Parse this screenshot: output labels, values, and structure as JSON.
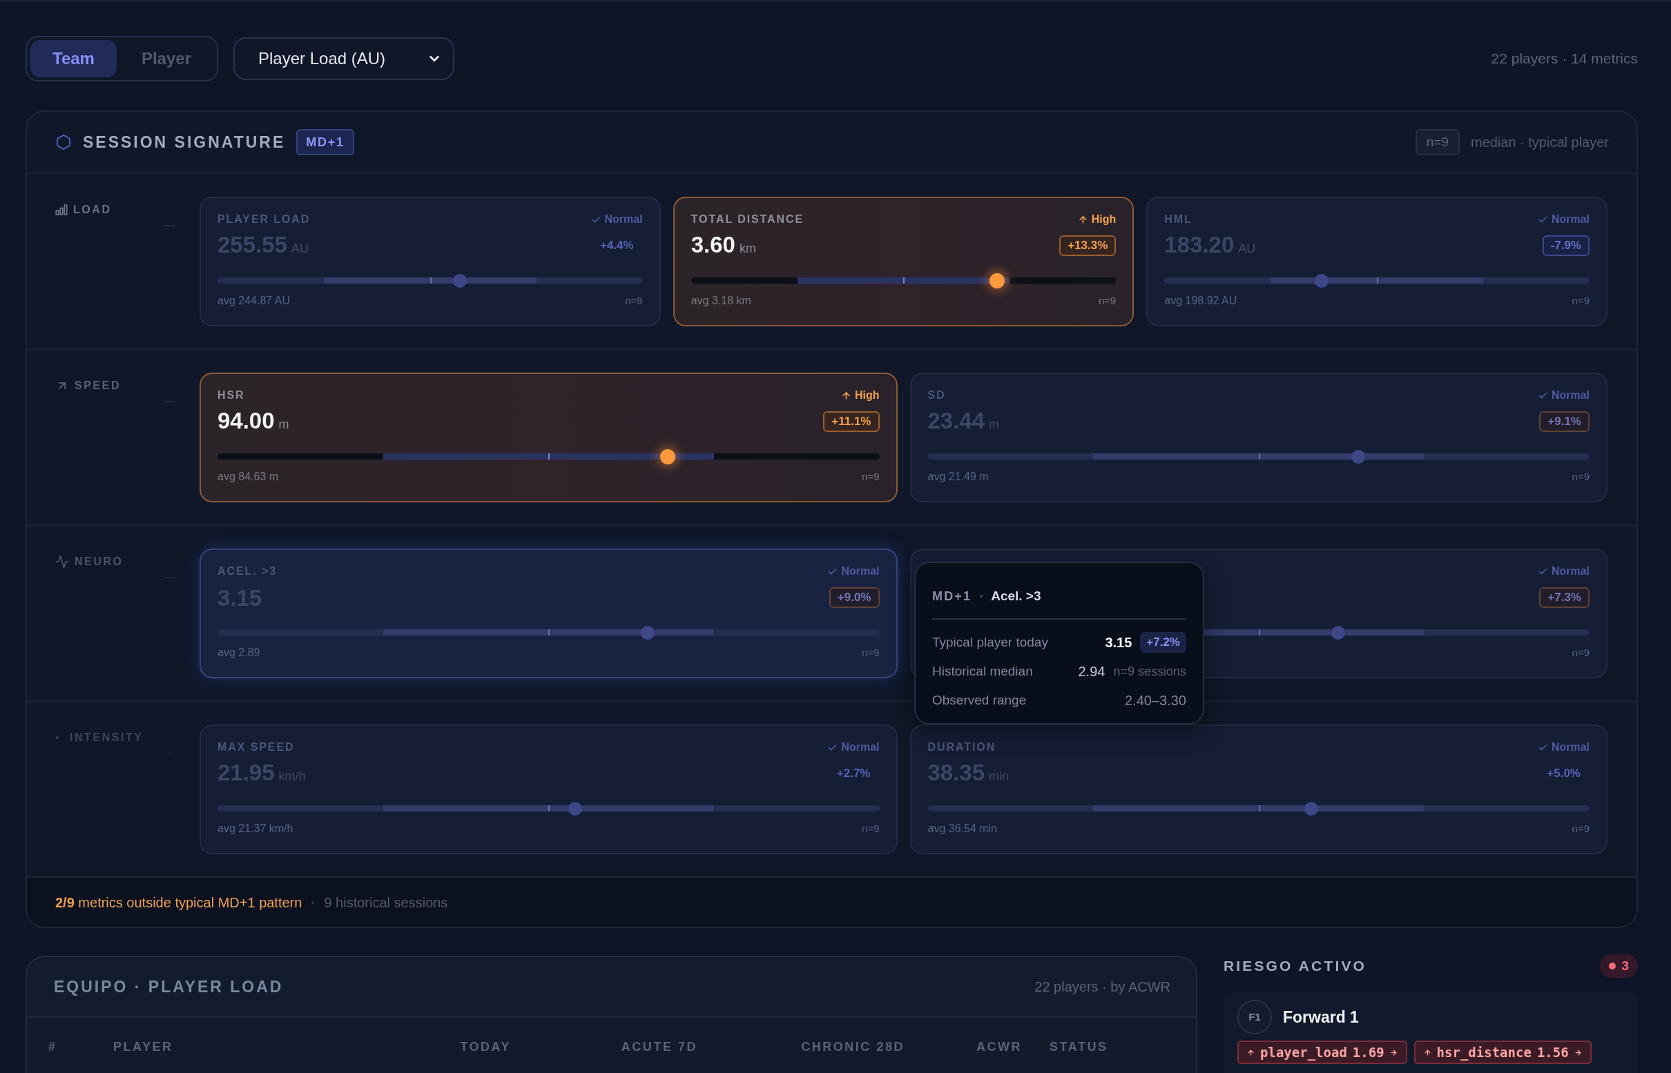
{
  "view_toggle": [
    {
      "label": "Team",
      "selected": true
    },
    {
      "label": "Player",
      "selected": false
    }
  ],
  "metric_select": {
    "value": "Player Load (AU)"
  },
  "summary": "22 players · 14 metrics",
  "session_signature": {
    "title": "SESSION SIGNATURE",
    "day_badge": "MD+1",
    "sample": "n=9",
    "caption": "median · typical player",
    "groups": [
      {
        "kind": "load",
        "label": "LOAD",
        "metrics": [
          {
            "label": "PLAYER LOAD",
            "value": "255.55",
            "unit": "AU",
            "high": false,
            "status_text": "Normal",
            "delta": {
              "text": "+4.4%",
              "kind": "plain"
            },
            "level": 0.57,
            "avg": "avg 244.87 AU",
            "n": "n=9",
            "highlighted": false
          },
          {
            "label": "TOTAL DISTANCE",
            "value": "3.60",
            "unit": "km",
            "high": true,
            "status_text": "High",
            "delta": {
              "text": "+13.3%",
              "kind": "above"
            },
            "level": 0.72,
            "avg": "avg 3.18 km",
            "n": "n=9",
            "highlighted": false
          },
          {
            "label": "HML",
            "value": "183.20",
            "unit": "AU",
            "high": false,
            "status_text": "Normal",
            "delta": {
              "text": "-7.9%",
              "kind": "below"
            },
            "level": 0.37,
            "avg": "avg 198.92 AU",
            "n": "n=9",
            "highlighted": false
          }
        ]
      },
      {
        "kind": "speed",
        "label": "SPEED",
        "metrics": [
          {
            "label": "HSR",
            "value": "94.00",
            "unit": "m",
            "high": true,
            "status_text": "High",
            "delta": {
              "text": "+11.1%",
              "kind": "above"
            },
            "level": 0.68,
            "avg": "avg 84.63 m",
            "n": "n=9",
            "highlighted": false
          },
          {
            "label": "SD",
            "value": "23.44",
            "unit": "m",
            "high": false,
            "status_text": "Normal",
            "delta": {
              "text": "+9.1%",
              "kind": "above"
            },
            "level": 0.65,
            "avg": "avg 21.49 m",
            "n": "n=9",
            "highlighted": false
          }
        ]
      },
      {
        "kind": "neuro",
        "label": "NEURO",
        "metrics": [
          {
            "label": "ACEL. >3",
            "value": "3.15",
            "high": false,
            "status_text": "Normal",
            "delta": {
              "text": "+9.0%",
              "kind": "above"
            },
            "level": 0.65,
            "avg": "avg 2.89",
            "n": "n=9",
            "highlighted": true
          },
          {
            "high": false,
            "status_text": "Normal",
            "delta": {
              "text": "+7.3%",
              "kind": "above"
            },
            "level": 0.62,
            "n": "n=9",
            "highlighted": false
          }
        ]
      },
      {
        "kind": "intensity",
        "label": "INTENSITY",
        "metrics": [
          {
            "label": "MAX SPEED",
            "value": "21.95",
            "unit": "km/h",
            "high": false,
            "status_text": "Normal",
            "delta": {
              "text": "+2.7%",
              "kind": "plain"
            },
            "level": 0.54,
            "avg": "avg 21.37 km/h",
            "n": "n=9",
            "highlighted": false
          },
          {
            "label": "DURATION",
            "value": "38.35",
            "unit": "min",
            "high": false,
            "status_text": "Normal",
            "delta": {
              "text": "+5.0%",
              "kind": "plain"
            },
            "level": 0.58,
            "avg": "avg 36.54 min",
            "n": "n=9",
            "highlighted": false
          }
        ]
      }
    ],
    "tooltip": {
      "day": "MD+1",
      "metric": "Acel. >3",
      "rows": [
        {
          "kind": "today",
          "label": "Typical player today",
          "value": "3.15",
          "delta": "+7.2%"
        },
        {
          "kind": "median",
          "label": "Historical median",
          "value": "2.94",
          "note": "n=9 sessions"
        },
        {
          "kind": "range",
          "label": "Observed range",
          "value": "2.40–3.30"
        }
      ]
    },
    "footer": {
      "summary": "**2/9** metrics outside typical MD+1 pattern",
      "sessions": "9 historical sessions"
    }
  },
  "team_table": {
    "title": "EQUIPO · PLAYER LOAD",
    "caption": "22 players · by ACWR",
    "columns": [
      "#",
      "PLAYER",
      "TODAY",
      "ACUTE 7D",
      "CHRONIC 28D",
      "ACWR",
      "STATUS"
    ]
  },
  "risk": {
    "title": "RIESGO ACTIVO",
    "count": "3",
    "players": [
      {
        "initials": "F1",
        "name": "Forward 1",
        "flags": [
          {
            "metric": "player_load",
            "value": "1.69"
          },
          {
            "metric": "hsr_distance",
            "value": "1.56"
          }
        ]
      }
    ]
  }
}
